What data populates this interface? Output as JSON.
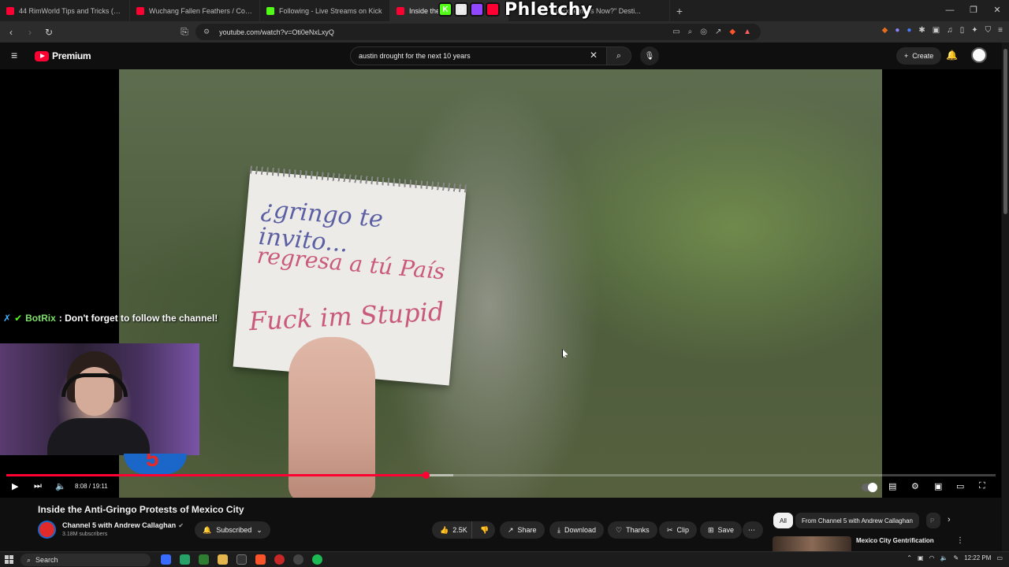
{
  "browser": {
    "tabs": [
      {
        "title": "44 RimWorld Tips and Tricks (No Ha...",
        "color": "#ff0033"
      },
      {
        "title": "Wuchang Fallen Feathers / Comman...",
        "color": "#ff0033"
      },
      {
        "title": "Following - Live Streams on Kick",
        "color": "#53fc18"
      },
      {
        "title": "Inside the",
        "color": "#ff0033"
      },
      {
        "title": "ll Extremists Now?\" Desti...",
        "color": "#ff0033"
      }
    ],
    "overlay_text": "Phletchy",
    "overlay_badge_letters": [
      "K",
      "D"
    ],
    "url": "youtube.com/watch?v=Oti0eNxLxyQ"
  },
  "youtube": {
    "logo_text": "Premium",
    "search_query": "austin drought for the next 10 years",
    "create_label": "Create"
  },
  "video": {
    "sign_line1": "¿gringo te invito...",
    "sign_line2": "regresa a tú País",
    "sign_line3": "Fuck im Stupid",
    "current_time": "8:08",
    "duration": "19:11",
    "played_fraction": 0.424,
    "buffered_fraction": 0.452
  },
  "chat": {
    "user": "BotRix",
    "message": ": Don't forget to follow the channel!"
  },
  "meta": {
    "title": "Inside the Anti-Gringo Protests of Mexico City",
    "channel": "Channel 5 with Andrew Callaghan",
    "subscribers": "3.18M subscribers",
    "subscribed_label": "Subscribed",
    "likes": "2.5K",
    "share_label": "Share",
    "download_label": "Download",
    "thanks_label": "Thanks",
    "clip_label": "Clip",
    "save_label": "Save"
  },
  "sidebar": {
    "chips": [
      "All",
      "From Channel 5 with Andrew Callaghan",
      "P"
    ],
    "rec_title": "Mexico City Gentrification"
  },
  "taskbar": {
    "search_label": "Search",
    "clock": "12:22 PM"
  },
  "colors": {
    "accent": "#ff0033",
    "background": "#0f0f0f",
    "kick_green": "#53fc18"
  }
}
